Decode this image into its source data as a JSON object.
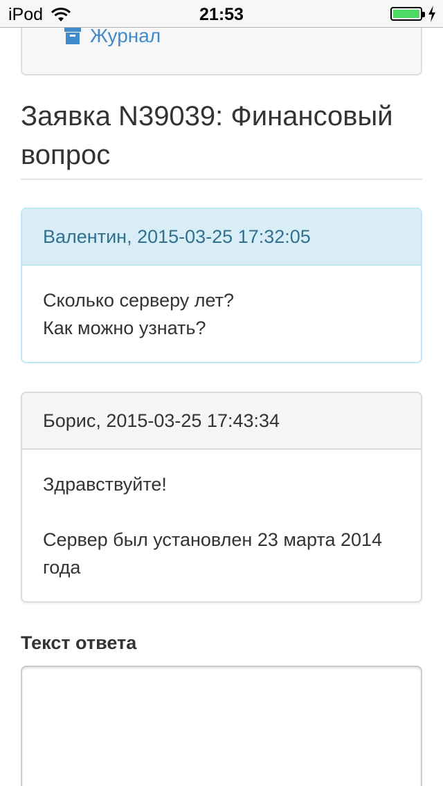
{
  "status_bar": {
    "device": "iPod",
    "time": "21:53",
    "battery_color": "#4cd964"
  },
  "nav": {
    "journal_label": "Журнал",
    "journal_icon": "archive-icon",
    "link_color": "#428bca"
  },
  "ticket": {
    "title": "Заявка N39039: Финансовый вопрос"
  },
  "messages": [
    {
      "header": "Валентин, 2015-03-25 17:32:05",
      "lines": [
        "Сколько серверу лет?",
        "Как можно узнать?"
      ]
    },
    {
      "header": "Борис, 2015-03-25 17:43:34",
      "lines": [
        "Здравствуйте!",
        "Сервер был установлен 23 марта 2014 года"
      ]
    }
  ],
  "reply": {
    "label": "Текст ответа",
    "value": ""
  }
}
